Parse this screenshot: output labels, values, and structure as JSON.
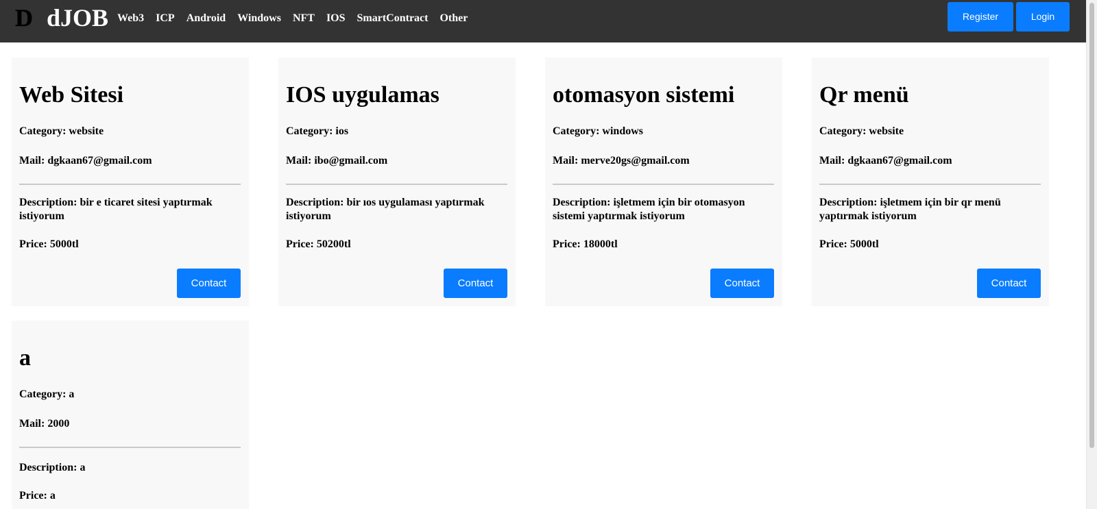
{
  "navbar": {
    "logo_mark": "D",
    "brand": "dJOB",
    "links": [
      "Web3",
      "ICP",
      "Android",
      "Windows",
      "NFT",
      "IOS",
      "SmartContract",
      "Other"
    ],
    "register_label": "Register",
    "login_label": "Login"
  },
  "labels": {
    "category": "Category: ",
    "mail": "Mail: ",
    "description": "Description: ",
    "price": "Price: ",
    "contact": "Contact"
  },
  "jobs": [
    {
      "title": "Web Sitesi",
      "category": "website",
      "mail": "dgkaan67@gmail.com",
      "description": "bir e ticaret sitesi yaptırmak istiyorum",
      "price": "5000tl"
    },
    {
      "title": "IOS uygulamas",
      "category": "ios",
      "mail": "ibo@gmail.com",
      "description": "bir ıos uygulaması yaptırmak istiyorum",
      "price": "50200tl"
    },
    {
      "title": "otomasyon sistemi",
      "category": "windows",
      "mail": "merve20gs@gmail.com",
      "description": "işletmem için bir otomasyon sistemi yaptırmak istiyorum",
      "price": "18000tl"
    },
    {
      "title": "Qr menü",
      "category": "website",
      "mail": "dgkaan67@gmail.com",
      "description": "işletmem için bir qr menü yaptırmak istiyorum",
      "price": "5000tl"
    },
    {
      "title": "a",
      "category": "a",
      "mail": "2000",
      "description": "a",
      "price": "a"
    }
  ]
}
